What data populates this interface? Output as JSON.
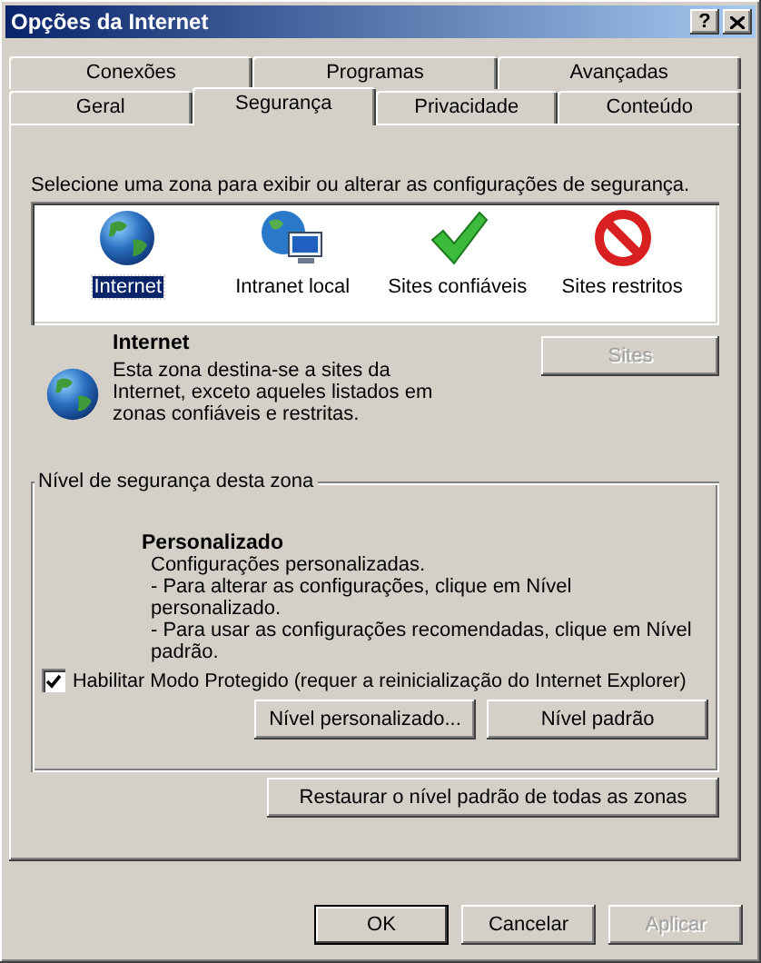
{
  "window": {
    "title": "Opções da Internet",
    "controls": [
      {
        "kind": "help",
        "label": "?"
      },
      {
        "kind": "close"
      }
    ]
  },
  "tab_rows": [
    [
      {
        "label": "Conexões",
        "selected": false
      },
      {
        "label": "Programas",
        "selected": false
      },
      {
        "label": "Avançadas",
        "selected": false
      }
    ],
    [
      {
        "label": "Geral",
        "selected": false
      },
      {
        "label": "Segurança",
        "selected": true
      },
      {
        "label": "Privacidade",
        "selected": false
      },
      {
        "label": "Conteúdo",
        "selected": false
      }
    ]
  ],
  "prompt": "Selecione uma zona para exibir ou alterar as configurações de segurança.",
  "zones": [
    {
      "label": "Internet",
      "kind": "globe",
      "selected": true
    },
    {
      "label": "Intranet local",
      "kind": "network",
      "selected": false
    },
    {
      "label": "Sites confiáveis",
      "kind": "check",
      "selected": false
    },
    {
      "label": "Sites restritos",
      "kind": "forbidden",
      "selected": false
    }
  ],
  "zone_info": {
    "kind": "globe",
    "title": "Internet",
    "description": "Esta zona destina-se a sites da Internet, exceto aqueles listados em zonas confiáveis e restritas.",
    "sites_button": {
      "label": "Sites",
      "disabled": true
    }
  },
  "security_level": {
    "legend": "Nível de segurança desta zona",
    "level_name": "Personalizado",
    "lines": [
      "Configurações personalizadas.",
      "- Para alterar as configurações, clique em Nível personalizado.",
      "- Para usar as configurações recomendadas, clique em Nível padrão."
    ],
    "protected_mode": {
      "label": "Habilitar Modo Protegido (requer a reinicialização do Internet Explorer)",
      "checked": true
    },
    "buttons": [
      {
        "label": "Nível personalizado...",
        "disabled": false
      },
      {
        "label": "Nível padrão",
        "disabled": false
      }
    ]
  },
  "restore_button": {
    "label": "Restaurar o nível padrão de todas as zonas",
    "disabled": false
  },
  "footer_buttons": [
    {
      "label": "OK",
      "default": true,
      "disabled": false
    },
    {
      "label": "Cancelar",
      "default": false,
      "disabled": false
    },
    {
      "label": "Aplicar",
      "default": false,
      "disabled": true
    }
  ]
}
